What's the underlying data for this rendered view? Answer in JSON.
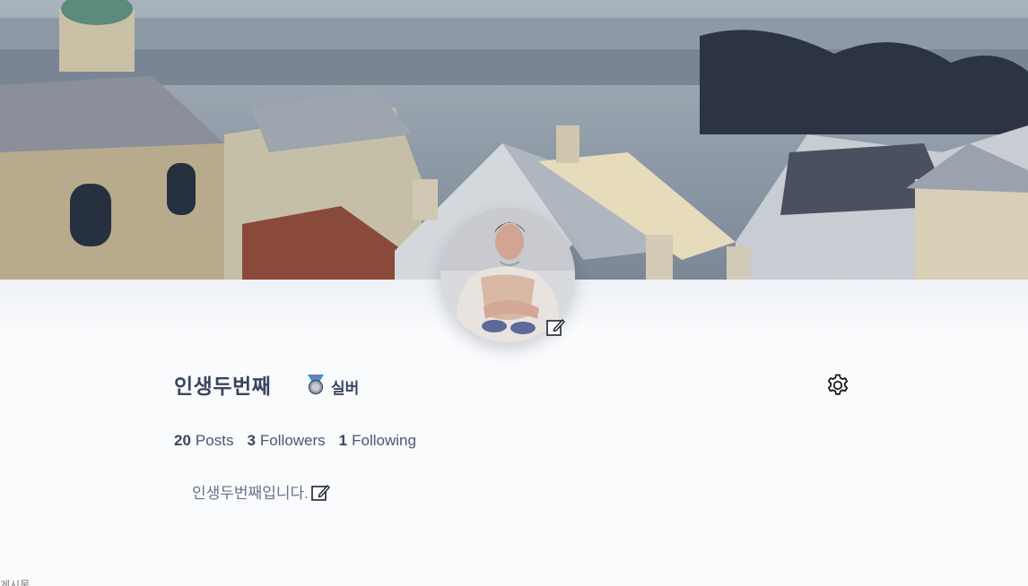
{
  "profile": {
    "username": "인생두번째",
    "badge": {
      "icon": "silver-medal-icon",
      "label": "실버"
    },
    "bio": "인생두번째입니다."
  },
  "stats": {
    "posts": {
      "count": "20",
      "label": "Posts"
    },
    "followers": {
      "count": "3",
      "label": "Followers"
    },
    "following": {
      "count": "1",
      "label": "Following"
    }
  },
  "footer_fragment": "게시물",
  "colors": {
    "text_primary": "#3a4560",
    "text_muted": "#6a7188",
    "page_bg": "#fafbfd"
  }
}
